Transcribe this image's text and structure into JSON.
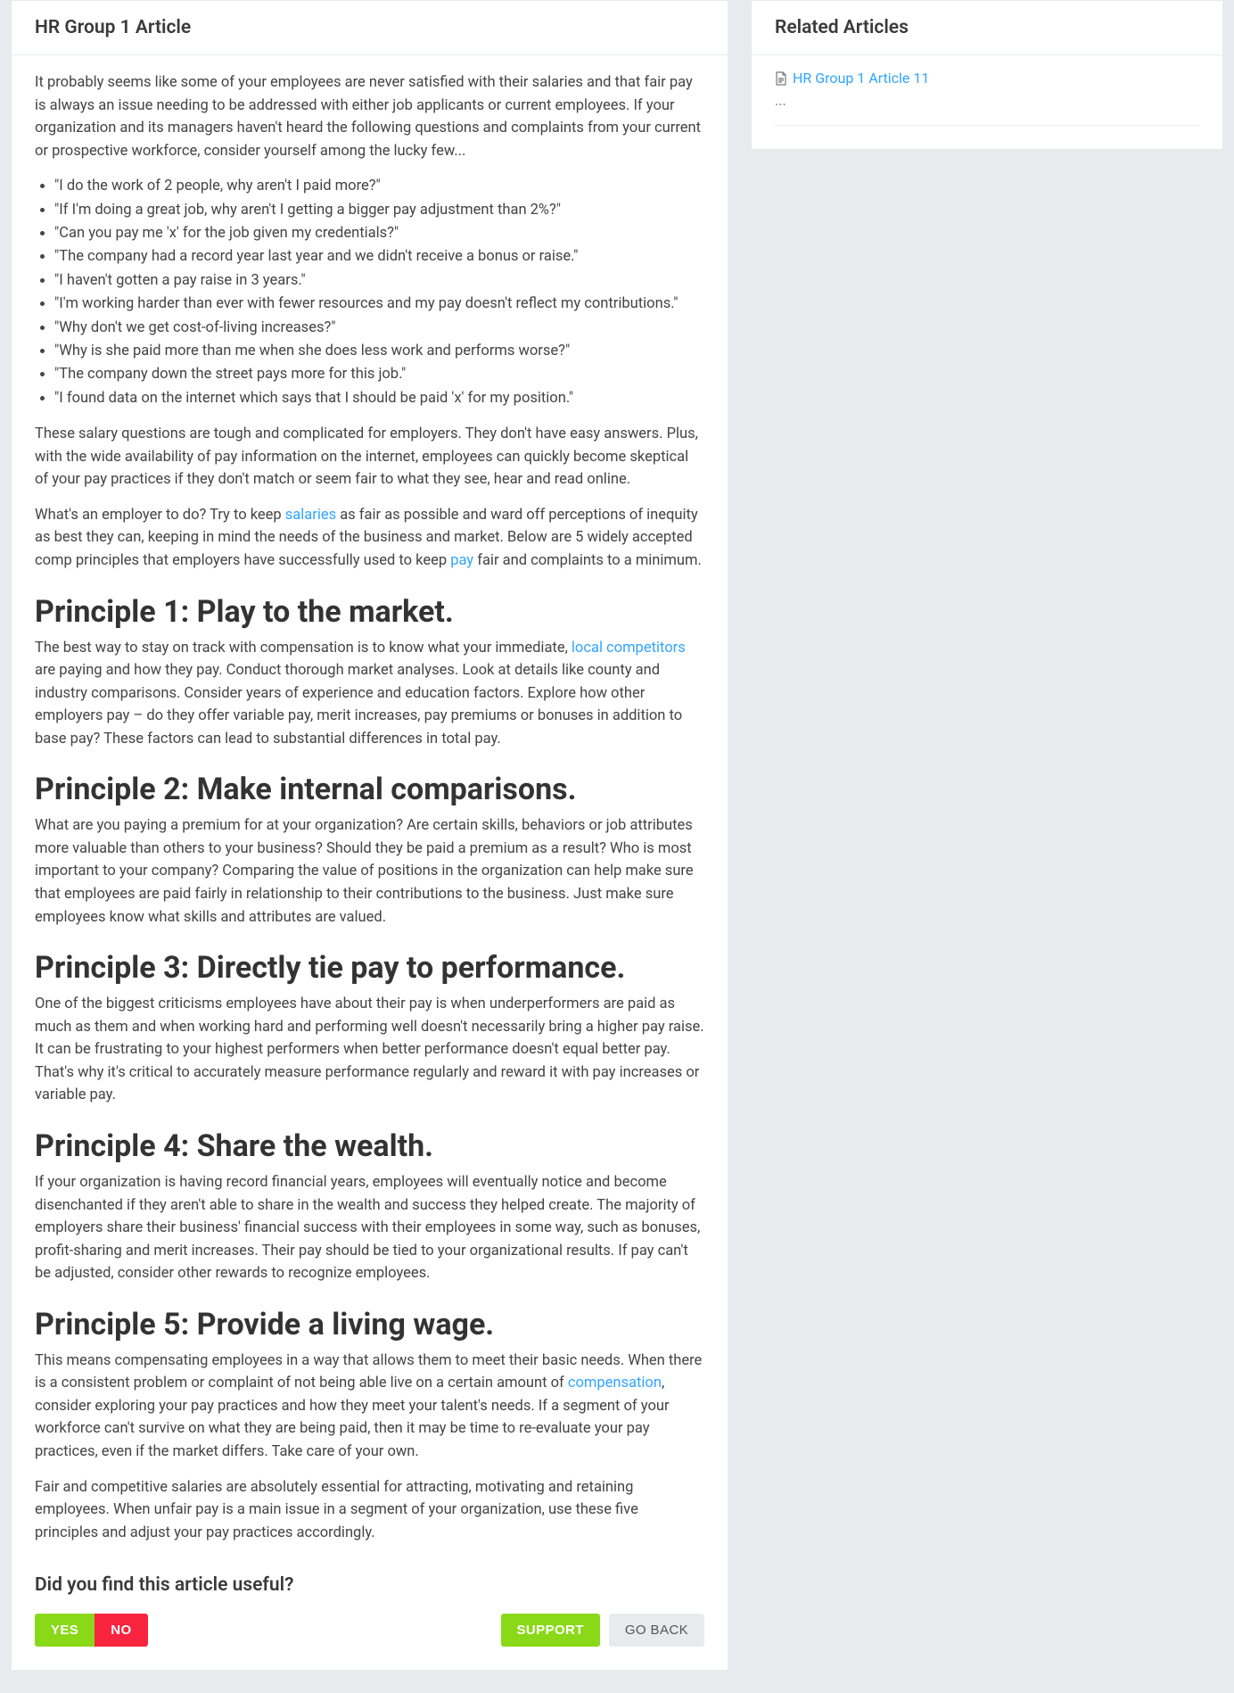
{
  "article": {
    "title": "HR Group 1 Article",
    "intro": "It probably seems like some of your employees are never satisfied with their salaries and that fair pay is always an issue needing to be addressed with either job applicants or current employees. If your organization and its managers haven't heard the following questions and complaints from your current or prospective workforce, consider yourself among the lucky few...",
    "quotes": [
      "\"I do the work of 2 people, why aren't I paid more?\"",
      "\"If I'm doing a great job, why aren't I getting a bigger pay adjustment than 2%?\"",
      "\"Can you pay me 'x' for the job given my credentials?\"",
      "\"The company had a record year last year and we didn't receive a bonus or raise.\"",
      "\"I haven't gotten a pay raise in 3 years.\"",
      "\"I'm working harder than ever with fewer resources and my pay doesn't reflect my contributions.\"",
      "\"Why don't we get cost-of-living increases?\"",
      "\"Why is she paid more than me when she does less work and performs worse?\"",
      "\"The company down the street pays more for this job.\"",
      "\"I found data on the internet which says that I should be paid 'x' for my position.\""
    ],
    "para2": "These salary questions are tough and complicated for employers. They don't have easy answers. Plus, with the wide availability of pay information on the internet, employees can quickly become skeptical of your pay practices if they don't match or seem fair to what they see, hear and read online.",
    "para3_prefix": "What's an employer to do? Try to keep ",
    "para3_link1": "salaries",
    "para3_mid": " as fair as possible and ward off perceptions of inequity as best they can, keeping in mind the needs of the business and market. Below are 5 widely accepted comp principles that employers have successfully used to keep ",
    "para3_link2": "pay",
    "para3_suffix": " fair and complaints to a minimum.",
    "p1_heading": "Principle 1: Play to the market.",
    "p1_text_prefix": "The best way to stay on track with compensation is to know what your immediate, ",
    "p1_link": "local competitors",
    "p1_text_suffix": " are paying and how they pay. Conduct thorough market analyses. Look at details like county and industry comparisons. Consider years of experience and education factors. Explore how other employers pay – do they offer variable pay, merit increases, pay premiums or bonuses in addition to base pay? These factors can lead to substantial differences in total pay.",
    "p2_heading": "Principle 2: Make internal comparisons.",
    "p2_text": "What are you paying a premium for at your organization? Are certain skills, behaviors or job attributes more valuable than others to your business? Should they be paid a premium as a result? Who is most important to your company? Comparing the value of positions in the organization can help make sure that employees are paid fairly in relationship to their contributions to the business. Just make sure employees know what skills and attributes are valued.",
    "p3_heading": "Principle 3: Directly tie pay to performance.",
    "p3_text": "One of the biggest criticisms employees have about their pay is when underperformers are paid as much as them and when working hard and performing well doesn't necessarily bring a higher pay raise. It can be frustrating to your highest performers when better performance doesn't equal better pay. That's why it's critical to accurately measure performance regularly and reward it with pay increases or variable pay.",
    "p4_heading": "Principle 4: Share the wealth.",
    "p4_text": "If your organization is having record financial years, employees will eventually notice and become disenchanted if they aren't able to share in the wealth and success they helped create. The majority of employers share their business' financial success with their employees in some way, such as bonuses, profit-sharing and merit increases. Their pay should be tied to your organizational results. If pay can't be adjusted, consider other rewards to recognize employees.",
    "p5_heading": "Principle 5: Provide a living wage.",
    "p5_text_prefix": "This means compensating employees in a way that allows them to meet their basic needs. When there is a consistent problem or complaint of not being able live on a certain amount of ",
    "p5_link": "compensation",
    "p5_text_suffix": ", consider exploring your pay practices and how they meet your talent's needs. If a segment of your workforce can't survive on what they are being paid, then it may be time to re-evaluate your pay practices, even if the market differs. Take care of your own.",
    "closing": "Fair and competitive salaries are absolutely essential for attracting, motivating and retaining employees. When unfair pay is a main issue in a segment of your organization, use these five principles and adjust your pay practices accordingly."
  },
  "feedback": {
    "question": "Did you find this article useful?",
    "yes": "YES",
    "no": "NO",
    "support": "SUPPORT",
    "goback": "GO BACK"
  },
  "sidebar": {
    "heading": "Related Articles",
    "items": [
      {
        "label": "HR Group 1 Article 11"
      }
    ],
    "ellipsis": "..."
  }
}
